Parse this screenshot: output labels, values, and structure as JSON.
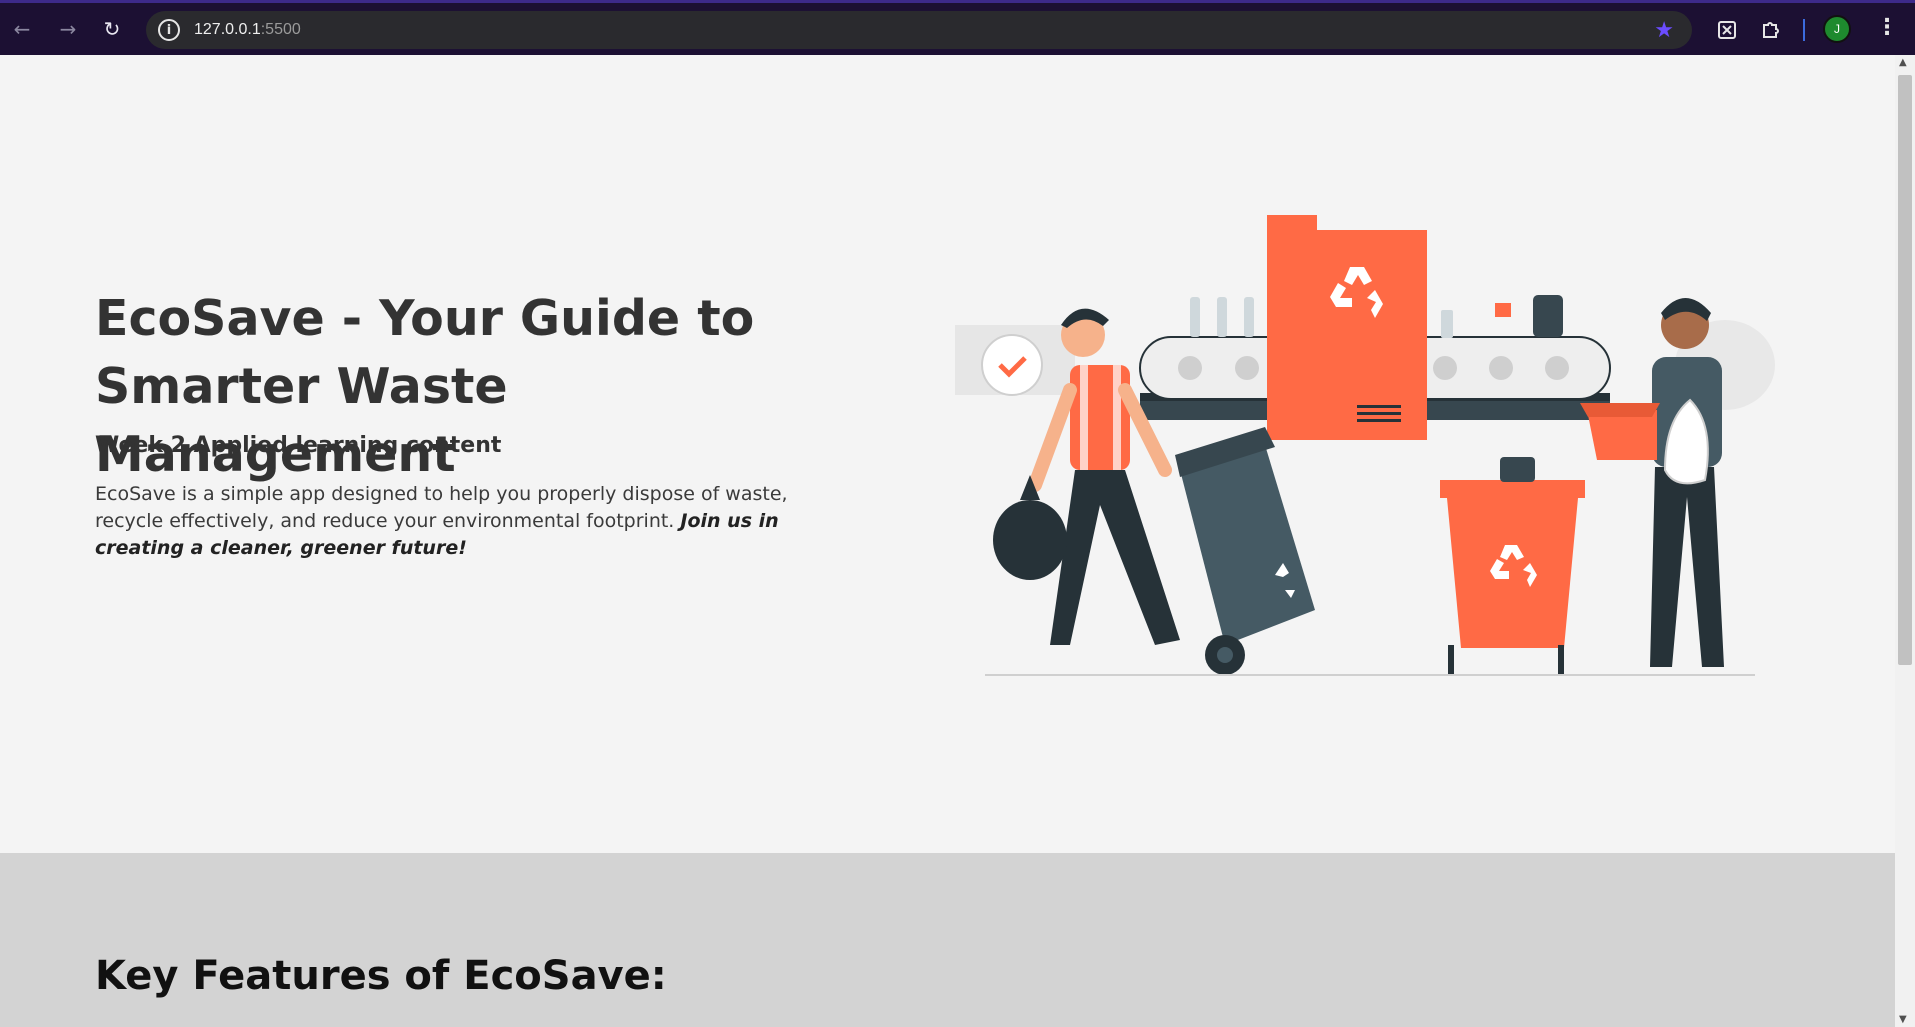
{
  "browser": {
    "url_host": "127.0.0.1",
    "url_port": ":5500",
    "avatar_letter": "J",
    "back_icon": "arrow-left-icon",
    "forward_icon": "arrow-right-icon",
    "reload_icon": "reload-icon",
    "accent_color": "#6b4cff"
  },
  "hero": {
    "title": "EcoSave - Your Guide to Smarter Waste Management",
    "subtitle": "Week 2 Applied learning content",
    "description": "EcoSave is a simple app designed to help you properly dispose of waste, recycle effectively, and reduce your environmental footprint.",
    "description_emphasis": "Join us in creating a cleaner, greener future!",
    "illustration_colors": {
      "orange": "#ff6a45",
      "slate": "#37474f",
      "dark": "#263238"
    }
  },
  "features": {
    "title": "Key Features of EcoSave:"
  }
}
